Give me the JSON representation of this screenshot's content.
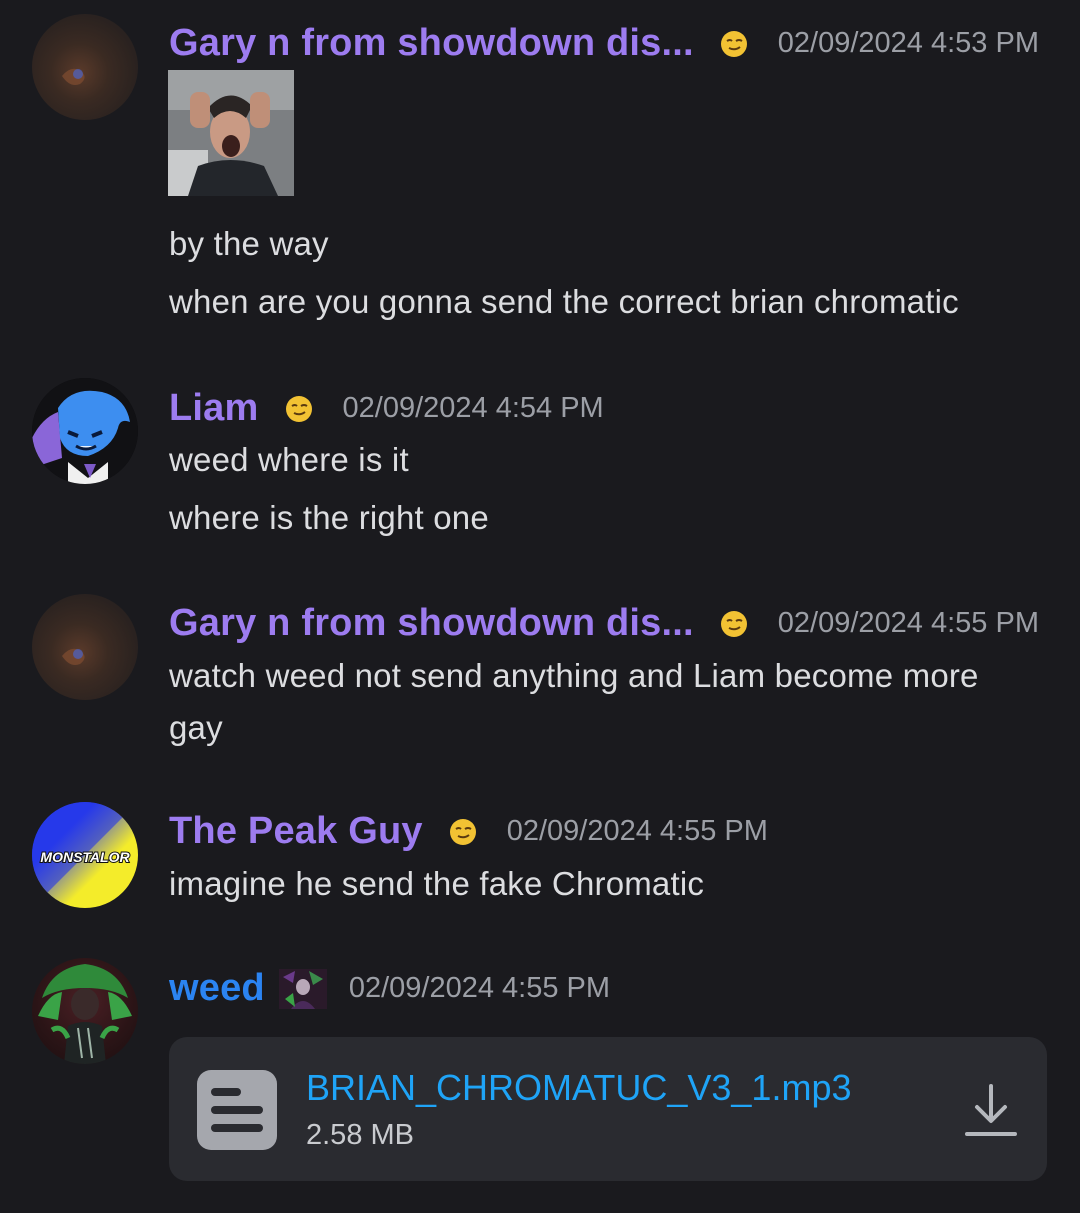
{
  "messages": [
    {
      "author": "Gary n from showdown dis...",
      "timestamp": "02/09/2024 4:53 PM",
      "lines": [
        "by the way",
        "when are you gonna send the correct brian chromatic"
      ]
    },
    {
      "author": "Liam",
      "timestamp": "02/09/2024 4:54 PM",
      "lines": [
        "weed where is it",
        "where is the right one"
      ]
    },
    {
      "author": "Gary n from showdown dis...",
      "timestamp": "02/09/2024 4:55 PM",
      "lines": [
        "watch weed not send anything and Liam become more",
        "gay"
      ]
    },
    {
      "author": "The Peak Guy",
      "timestamp": "02/09/2024 4:55 PM",
      "avatar_text": "MONSTALOR",
      "lines": [
        "imagine he send the fake Chromatic"
      ]
    },
    {
      "author": "weed",
      "timestamp": "02/09/2024 4:55 PM",
      "attachment": {
        "file_name": "BRIAN_CHROMATUC_V3_1.mp3",
        "file_size": "2.58 MB"
      }
    }
  ],
  "colors": {
    "background": "#1a1a1e",
    "username_purple": "#9d7cf0",
    "username_blue": "#2b84f2",
    "link_blue": "#1fa4f7",
    "timestamp": "#9c9fa6"
  },
  "icons": {
    "role_icon": "smirk-emoji-icon",
    "file_icon": "document-icon",
    "download_icon": "download-icon"
  }
}
